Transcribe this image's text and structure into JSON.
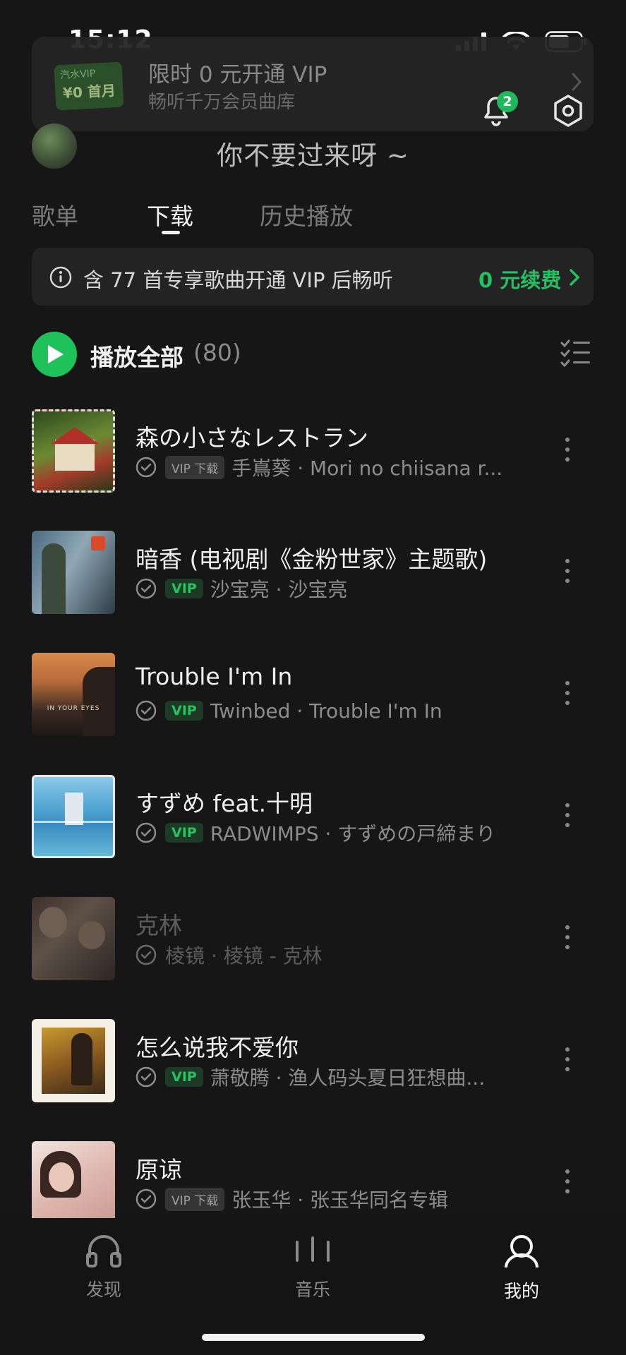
{
  "status_bar": {
    "time": "15:12"
  },
  "vip_banner": {
    "badge_line1": "汽水VIP",
    "badge_line2": "¥0 首月",
    "title": "限时 0 元开通 VIP",
    "subtitle": "畅听千万会员曲库"
  },
  "notifications": {
    "count": "2"
  },
  "profile": {
    "username": "你不要过来呀 ~"
  },
  "tabs": [
    {
      "label": "歌单"
    },
    {
      "label": "下载"
    },
    {
      "label": "历史播放"
    }
  ],
  "notice": {
    "text": "含 77 首专享歌曲开通 VIP 后畅听",
    "link": "0 元续费"
  },
  "play_all": {
    "label": "播放全部",
    "count": "(80)"
  },
  "songs": [
    {
      "title": "森の小さなレストラン",
      "tag": "VIP 下载",
      "subtitle": "手嶌葵 · Mori no chiisana r..."
    },
    {
      "title": "暗香 (电视剧《金粉世家》主题歌)",
      "tag": "VIP",
      "subtitle": "沙宝亮 · 沙宝亮"
    },
    {
      "title": "Trouble I'm In",
      "tag": "VIP",
      "subtitle": "Twinbed · Trouble I'm In"
    },
    {
      "title": "すずめ feat.十明",
      "tag": "VIP",
      "subtitle": "RADWIMPS · すずめの戸締まり"
    },
    {
      "title": "克林",
      "tag": "",
      "subtitle": "棱镜 · 棱镜 - 克林"
    },
    {
      "title": "怎么说我不爱你",
      "tag": "VIP",
      "subtitle": "萧敬腾 · 渔人码头夏日狂想曲..."
    },
    {
      "title": "原谅",
      "tag": "VIP 下载",
      "subtitle": "张玉华 · 张玉华同名专辑"
    }
  ],
  "bottom_nav": [
    {
      "label": "发现"
    },
    {
      "label": "音乐"
    },
    {
      "label": "我的"
    }
  ],
  "colors": {
    "accent": "#1fc25a",
    "background": "#161616"
  }
}
